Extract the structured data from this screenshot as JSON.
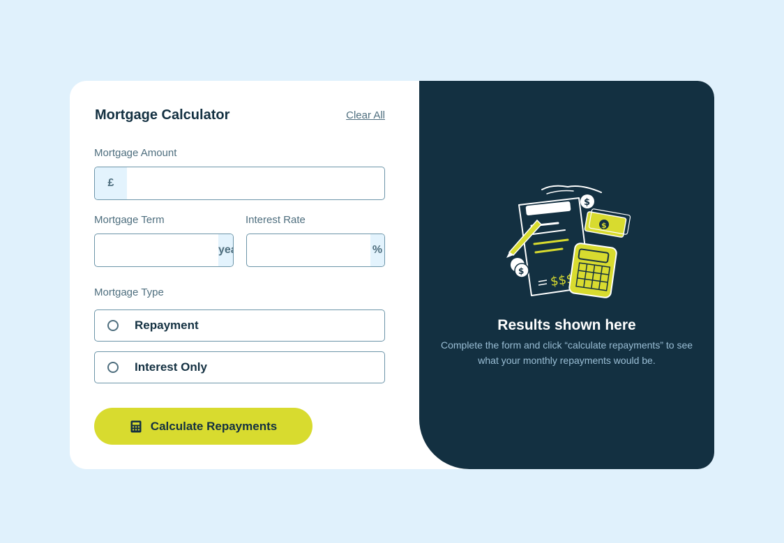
{
  "header": {
    "title": "Mortgage Calculator",
    "clear_all": "Clear All"
  },
  "amount": {
    "label": "Mortgage Amount",
    "prefix": "£",
    "value": ""
  },
  "term": {
    "label": "Mortgage Term",
    "suffix": "years",
    "value": ""
  },
  "rate": {
    "label": "Interest Rate",
    "suffix": "%",
    "value": ""
  },
  "type": {
    "label": "Mortgage Type",
    "options": [
      {
        "label": "Repayment",
        "selected": false
      },
      {
        "label": "Interest Only",
        "selected": false
      }
    ]
  },
  "calculate_button": {
    "label": "Calculate Repayments",
    "icon": "calculator-icon"
  },
  "results": {
    "title": "Results shown here",
    "description": "Complete the form and click “calculate repayments” to see what your monthly repayments would be."
  },
  "colors": {
    "background": "#e0f1fc",
    "dark_panel": "#133041",
    "accent": "#d8db2f",
    "slate": "#4e6e7e"
  }
}
